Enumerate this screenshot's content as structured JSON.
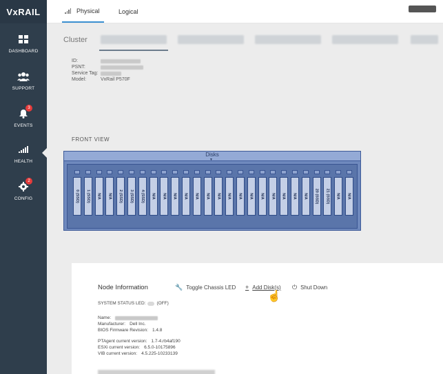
{
  "app": {
    "logo": "VxRAIL"
  },
  "sidebar": {
    "items": [
      {
        "label": "DASHBOARD",
        "icon": "dashboard-grid-icon"
      },
      {
        "label": "SUPPORT",
        "icon": "people-icon"
      },
      {
        "label": "EVENTS",
        "icon": "bell-icon",
        "badge": "3"
      },
      {
        "label": "HEALTH",
        "icon": "health-bars-icon"
      },
      {
        "label": "CONFIG",
        "icon": "gear-icon",
        "badge": "2"
      }
    ],
    "active": "HEALTH"
  },
  "topbar": {
    "tabs": [
      {
        "label": "Physical",
        "active": true
      },
      {
        "label": "Logical",
        "active": false
      }
    ]
  },
  "cluster": {
    "label": "Cluster"
  },
  "node_info_header": {
    "id_label": "ID:",
    "psnt_label": "PSNT:",
    "service_tag_label": "Service Tag:",
    "model_label": "Model:",
    "model_value": "VxRail P570F"
  },
  "front_view": {
    "title": "FRONT VIEW",
    "disks_label": "Disks",
    "slots": [
      "0 (SSD)",
      "1 (SSD)",
      "N/A",
      "N/A",
      "2 (SSD)",
      "3 (SSD)",
      "4 (SSD)",
      "N/A",
      "N/A",
      "N/A",
      "N/A",
      "N/A",
      "N/A",
      "N/A",
      "N/A",
      "N/A",
      "N/A",
      "N/A",
      "N/A",
      "N/A",
      "N/A",
      "N/A",
      "20 (SSD)",
      "21 (SSD)",
      "N/A",
      "N/A"
    ]
  },
  "node_panel": {
    "title": "Node Information",
    "actions": {
      "toggle": "Toggle Chassis LED",
      "add": "Add Disk(s)",
      "shutdown": "Shut Down"
    },
    "status_led_label": "SYSTEM STATUS LED:",
    "status_led_value": "(OFF)",
    "name_label": "Name:",
    "manufacturer_label": "Manufacturer:",
    "manufacturer_value": "Dell Inc.",
    "bios_label": "BIOS Firmware Revision:",
    "bios_value": "1.4.8",
    "ptagent_label": "PTAgent current version:",
    "ptagent_value": "1.7-4.rb4af190",
    "esxi_label": "ESXi current version:",
    "esxi_value": "6.5.0-10175896",
    "vib_label": "VIB current version:",
    "vib_value": "4.5.225-10233139"
  },
  "colors": {
    "sidebar_bg": "#2f3e4c",
    "tab_underline": "#3a8fd0",
    "chassis_bg": "#6f89bd",
    "badge_red": "#e53b3b"
  }
}
